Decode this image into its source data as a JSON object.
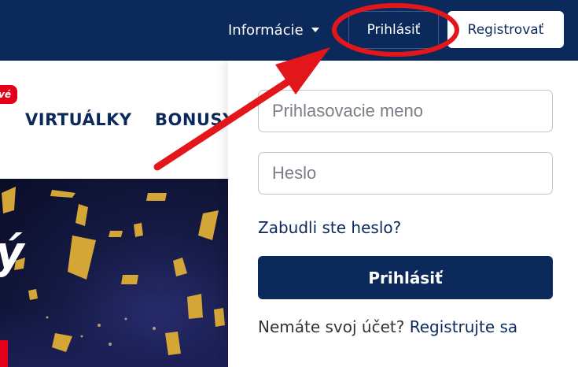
{
  "header": {
    "info_label": "Informácie",
    "login_label": "Prihlásiť",
    "register_label": "Registrovať"
  },
  "nav": {
    "new_badge": "vé",
    "items": [
      "VIRTUÁLKY",
      "BONUSY"
    ]
  },
  "banner": {
    "glyph": "ý"
  },
  "login_form": {
    "username_placeholder": "Prihlasovacie meno",
    "password_placeholder": "Heslo",
    "forgot_label": "Zabudli ste heslo?",
    "submit_label": "Prihlásiť",
    "no_account_text": "Nemáte svoj účet?",
    "register_link": "Registrujte sa"
  },
  "colors": {
    "brand": "#0b2a5b",
    "accent_red": "#e3001b",
    "white": "#ffffff"
  }
}
